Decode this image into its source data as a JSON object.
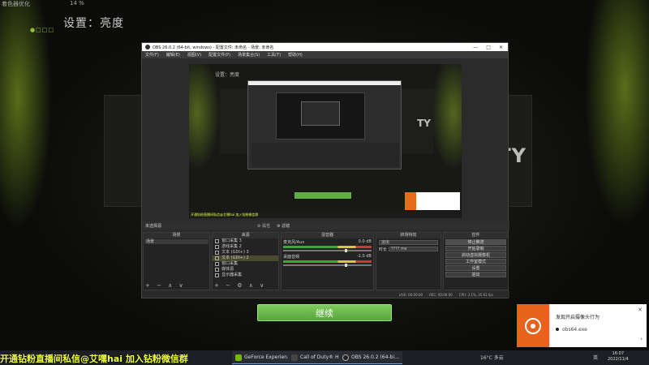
{
  "game": {
    "topbar": {
      "label": "着色器优化",
      "value": "14 %"
    },
    "title": "设置：亮度",
    "dots": "●□□□",
    "band_text": "TY",
    "continue_label": "继续"
  },
  "obs": {
    "title": "OBS 26.0.2 (64-bit, windows) - 配置文件: 未命名 - 场景: 未命名",
    "controls": [
      "—",
      "□",
      "✕"
    ],
    "menu": [
      "文件(F)",
      "编辑(E)",
      "视图(V)",
      "配置文件(P)",
      "场景集合(S)",
      "工具(T)",
      "帮助(H)"
    ],
    "preview": {
      "title": "设置：亮度",
      "band_text": "TY",
      "banner": "开通钻粉直播间私信@艾嘿hai 加入钻粉微信群"
    },
    "status_strip": {
      "left": "未选择源",
      "mid1": "⚙ 属性",
      "mid2": "⚙ 滤镜"
    },
    "docks": {
      "scenes": {
        "header": "场景",
        "items": [
          "场景"
        ],
        "footer": "+ − ∧ ∨"
      },
      "sources": {
        "header": "来源",
        "items": [
          "窗口采集 3",
          "游戏采集 2",
          "文本 (GDI+) 3",
          "文本 (GDI+) 2",
          "窗口采集",
          "媒体源",
          "显示器采集"
        ],
        "selected_index": 3,
        "footer": "+ − ⚙ ∧ ∨"
      },
      "mixer": {
        "header": "混音器",
        "channels": [
          {
            "name": "麦克风/Aux",
            "db": "0.0 dB"
          },
          {
            "name": "桌面音频",
            "db": "-1.0 dB"
          }
        ]
      },
      "transitions": {
        "header": "转场特效",
        "type": "淡出",
        "duration_label": "时长",
        "duration_value": "???? ms"
      },
      "controls": {
        "header": "控件",
        "buttons": [
          "停止推流",
          "开始录制",
          "启动虚拟摄像机",
          "工作室模式",
          "设置",
          "退出"
        ]
      }
    },
    "statusbar": {
      "live": "LIVE: 00:00:00",
      "rec": "REC: 00:00:00",
      "cpu": "CPU: 3.1%, 35.61 fps"
    }
  },
  "notification": {
    "title": "发现开启摄像头行为",
    "app": "obs64.exe",
    "close": "✕",
    "arrow": "›"
  },
  "taskbar": {
    "banner": "开通钻粉直播间私信@艾嘿hai 加入钻粉微信群",
    "apps": [
      "GeForce Experien...",
      "Call of Duty® HQ",
      "OBS 26.0.2 (64-bi..."
    ],
    "weather": "16°C 多云",
    "lang": "英",
    "time": "16:07",
    "date": "2022/11/4"
  },
  "colors": {
    "accent_green": "#5caf40",
    "toast_orange": "#e7621c",
    "banner_yellow": "#f0ff3c"
  }
}
